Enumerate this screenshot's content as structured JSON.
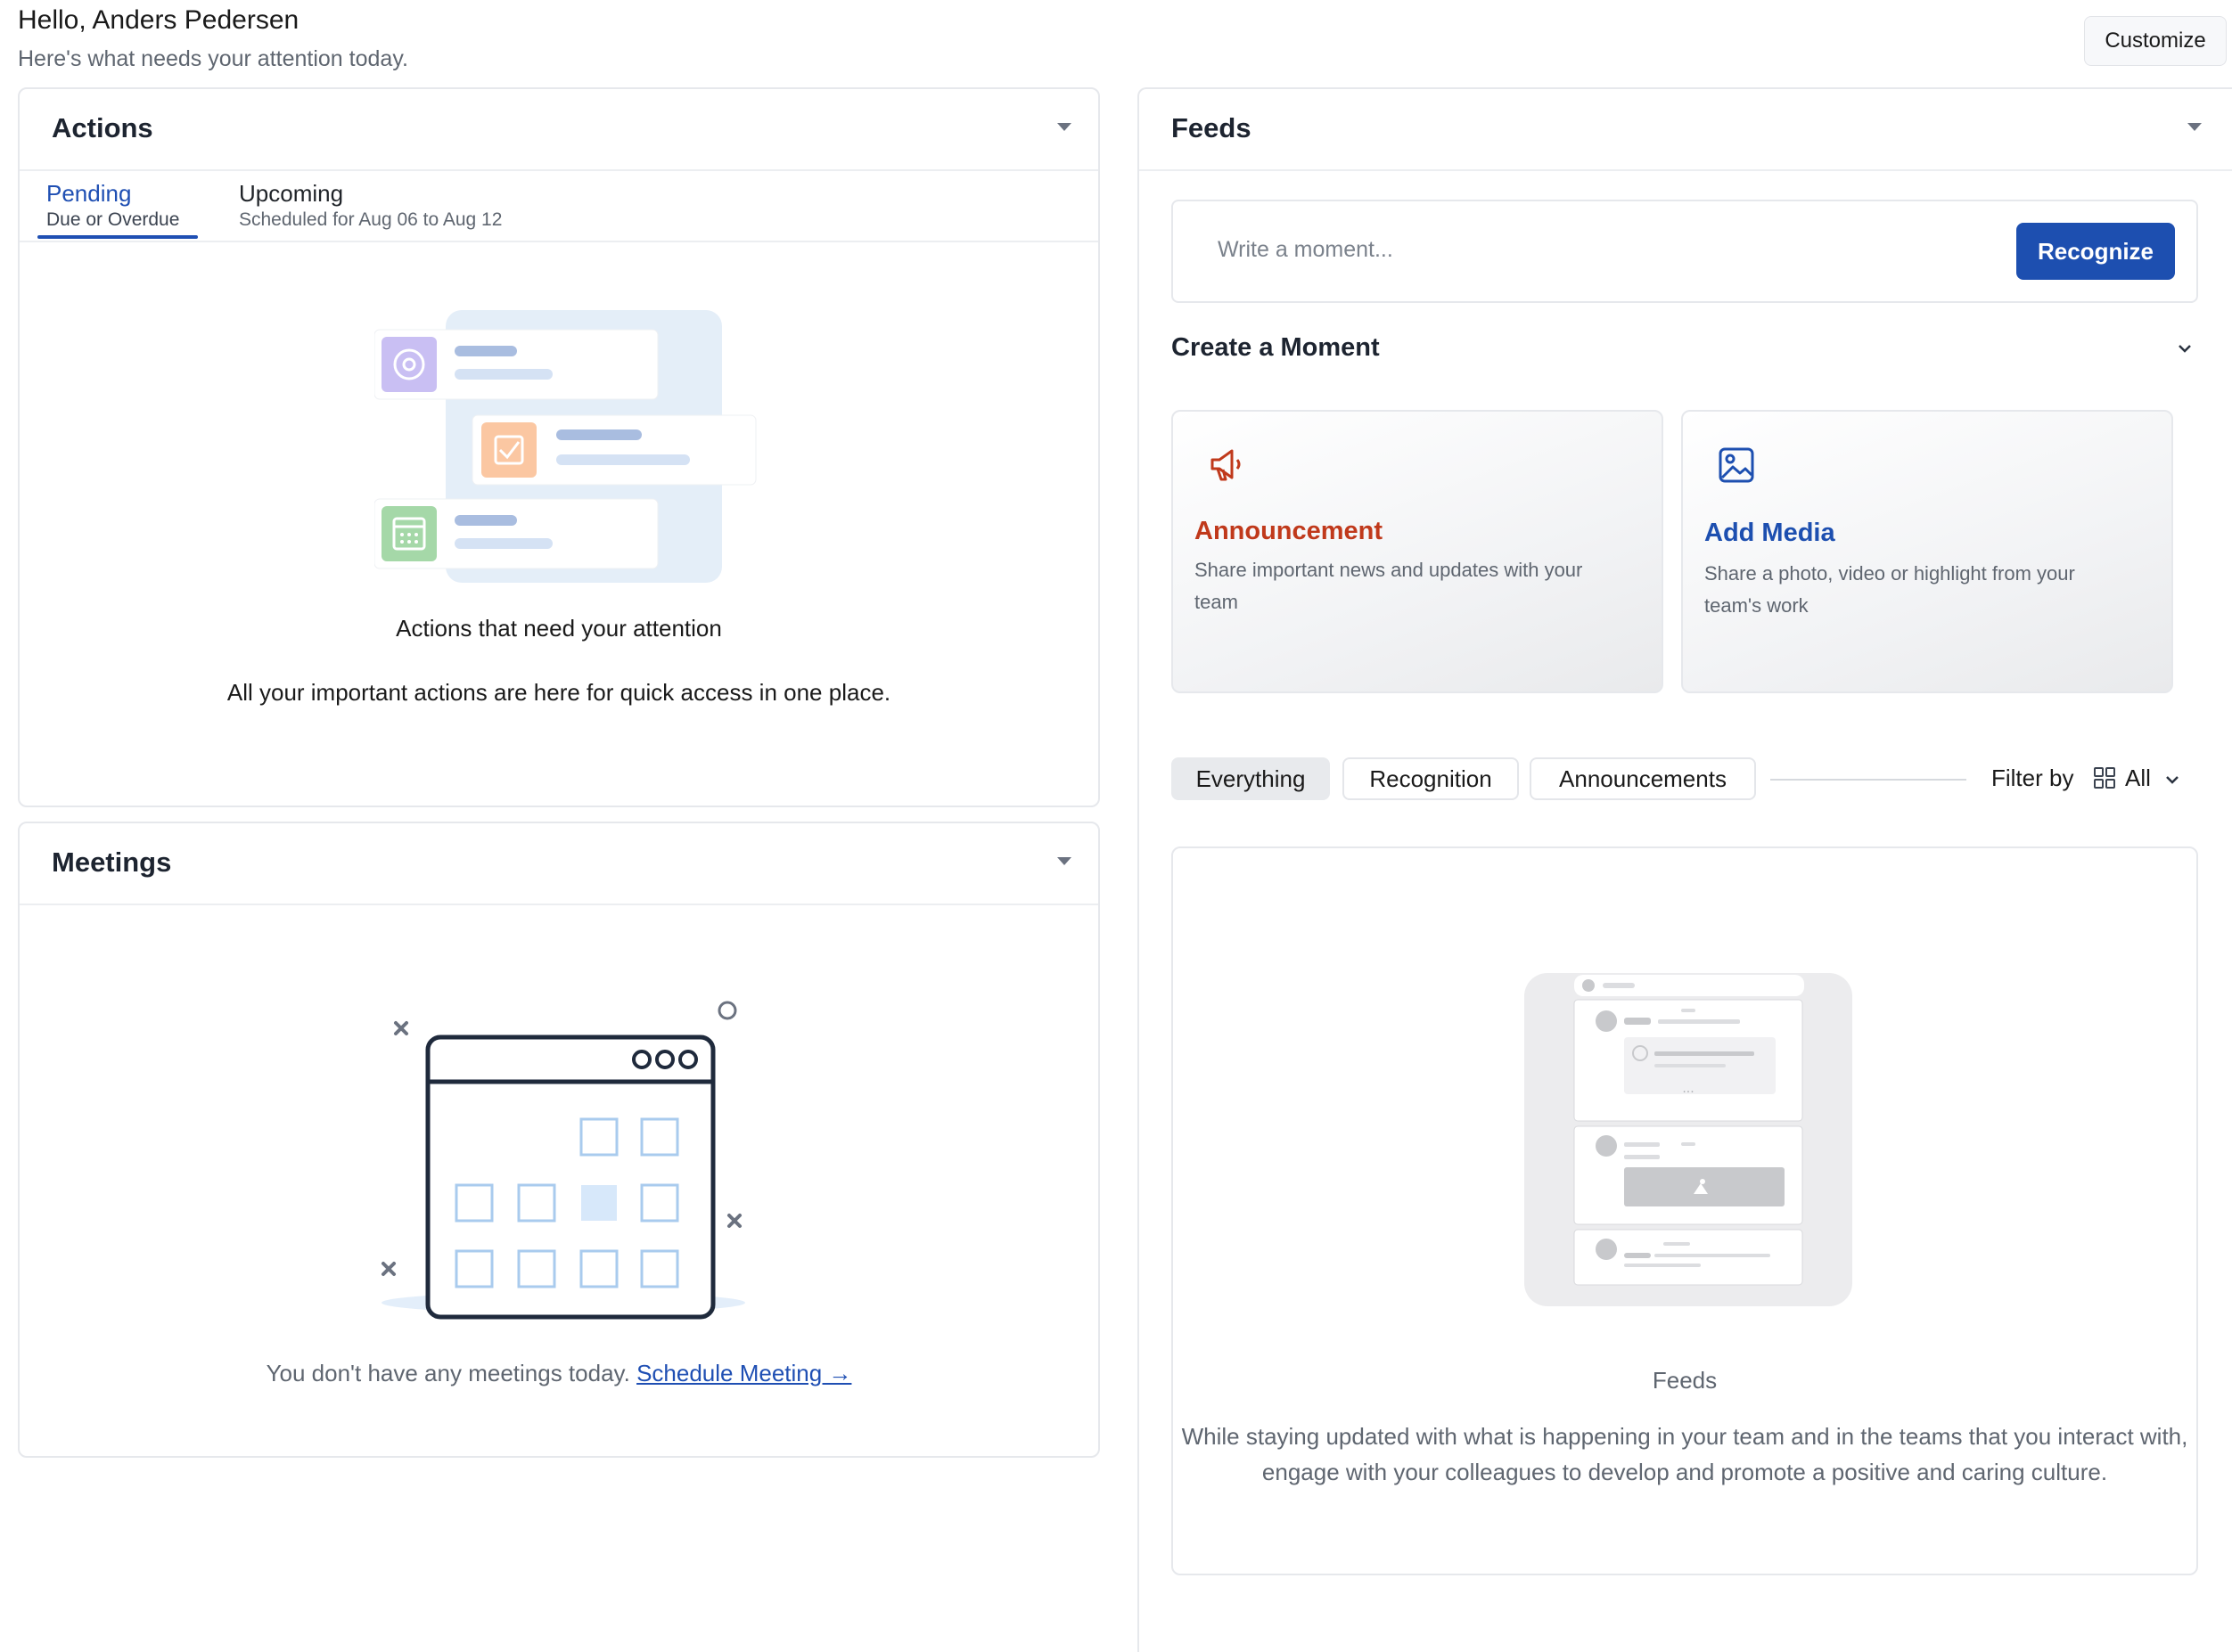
{
  "header": {
    "greeting": "Hello, Anders Pedersen",
    "subtitle": "Here's what needs your attention today.",
    "customize_label": "Customize"
  },
  "actions": {
    "title": "Actions",
    "tabs": [
      {
        "label": "Pending",
        "sub": "Due or Overdue",
        "active": true
      },
      {
        "label": "Upcoming",
        "sub": "Scheduled for Aug 06 to Aug 12",
        "active": false
      }
    ],
    "empty_title": "Actions that need your attention",
    "empty_text": "All your important actions are here for quick access in one place."
  },
  "meetings": {
    "title": "Meetings",
    "empty_text": "You don't have any meetings today.",
    "schedule_link": "Schedule Meeting →"
  },
  "feeds": {
    "title": "Feeds",
    "moment_placeholder": "Write a moment...",
    "recognize_label": "Recognize",
    "create_title": "Create a Moment",
    "cards": [
      {
        "title": "Announcement",
        "desc": "Share important news and updates with your team",
        "color": "#c0391b",
        "icon": "megaphone-icon"
      },
      {
        "title": "Add Media",
        "desc": "Share a photo, video or highlight from your team's work",
        "color": "#1d4fb0",
        "icon": "image-icon"
      }
    ],
    "filters": [
      "Everything",
      "Recognition",
      "Announcements"
    ],
    "active_filter": "Everything",
    "filter_by_label": "Filter by",
    "filter_value": "All",
    "empty_title": "Feeds",
    "empty_text": "While staying updated with what is happening in your team and in the teams that you interact with, engage with your colleagues to develop and promote a positive and caring culture."
  },
  "colors": {
    "accent": "#1d4fb0",
    "announcement": "#c0391b"
  }
}
